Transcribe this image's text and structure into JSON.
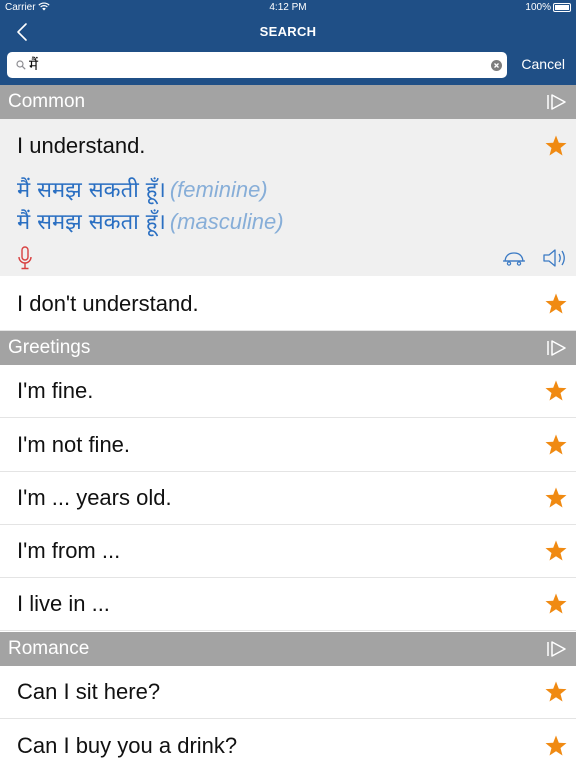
{
  "status_bar": {
    "carrier": "Carrier",
    "time": "4:12 PM",
    "battery": "100%"
  },
  "nav": {
    "title": "SEARCH"
  },
  "search": {
    "value": "मैं",
    "cancel_label": "Cancel"
  },
  "colors": {
    "nav_bar": "#1f4f86",
    "section_header": "#a3a3a3",
    "star": "#f08a12",
    "translation": "#2a6fc2",
    "mic": "#d84040",
    "icon_blue": "#3b7ac4"
  },
  "sections": [
    {
      "title": "Common",
      "items": [
        {
          "phrase": "I understand.",
          "translations": [
            {
              "text": "मैं समझ सकती हूँ।",
              "gender": "(feminine)"
            },
            {
              "text": "मैं समझ सकता हूँ।",
              "gender": "(masculine)"
            }
          ]
        },
        {
          "phrase": "I don't understand."
        }
      ]
    },
    {
      "title": "Greetings",
      "items": [
        {
          "phrase": "I'm fine."
        },
        {
          "phrase": "I'm not fine."
        },
        {
          "phrase": "I'm ... years old."
        },
        {
          "phrase": "I'm from ..."
        },
        {
          "phrase": "I live in ..."
        }
      ]
    },
    {
      "title": "Romance",
      "items": [
        {
          "phrase": "Can I sit here?"
        },
        {
          "phrase": "Can I buy you a drink?"
        }
      ]
    }
  ],
  "icons": {
    "back": "chevron-left-icon",
    "search": "magnifier-icon",
    "clear": "clear-circle-icon",
    "play": "play-all-icon",
    "star": "star-icon",
    "mic": "microphone-icon",
    "slow": "turtle-icon",
    "speaker": "speaker-icon"
  }
}
